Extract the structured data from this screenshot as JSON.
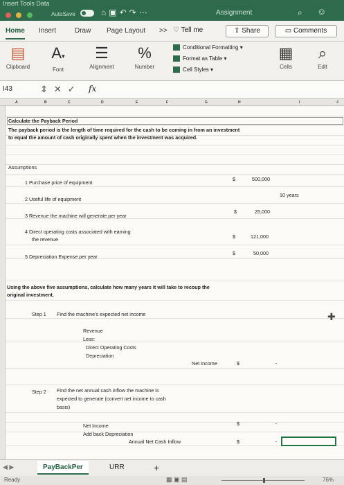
{
  "titlebar": {
    "menu_text": "Insert   Tools   Data",
    "autosave": "AutoSave",
    "assignment": "Assignment"
  },
  "ribbon_tabs": {
    "home": "Home",
    "insert": "Insert",
    "draw": "Draw",
    "page_layout": "Page Layout",
    "more": ">>",
    "tell_me": "Tell me",
    "share": "Share",
    "comments": "Comments"
  },
  "ribbon": {
    "clipboard": "Clipboard",
    "font": "Font",
    "alignment": "Alignment",
    "number": "Number",
    "conditional_formatting": "Conditional Formatting",
    "format_as_table": "Format as Table",
    "cell_styles": "Cell Styles",
    "cells": "Cells",
    "edit": "Edit"
  },
  "formula_bar": {
    "name_box": "I43",
    "fx": "fx"
  },
  "columns": [
    "A",
    "B",
    "C",
    "D",
    "E",
    "F",
    "G",
    "H",
    "I",
    "J"
  ],
  "sheet": {
    "title": "Calculate the Payback Period",
    "intro_1": "The payback period is the length of time required for the cash to be coming in from an investment",
    "intro_2": "to equal the amount of cash originally spent when the investment was acquired.",
    "assumptions_label": "Assumptions",
    "a1_label": "1 Purchase price of equipment",
    "a1_cur": "$",
    "a1_val": "500,000",
    "a2_label": "2 Useful life of equipment",
    "a2_val": "10 years",
    "a3_label": "3 Revenue the machine will generate per year",
    "a3_cur": "$",
    "a3_val": "25,000",
    "a4_label_1": "4 Direct operating costs associated with earning",
    "a4_label_2": "the revenue",
    "a4_cur": "$",
    "a4_val": "121,000",
    "a5_label": "5 Depreciation Expense per year",
    "a5_cur": "$",
    "a5_val": "50,000",
    "q_1": "Using the above five assumptions, calculate how many years it will take to recoup the",
    "q_2": "original investment.",
    "step1": "Step 1",
    "step1_desc": "Find the machine's expected net income",
    "revenue": "Revenue",
    "less": "Less:",
    "doc": "Direct Operating Costs",
    "depr": "Depreciation",
    "net_income": "Net Income",
    "ni_cur": "$",
    "ni_dash": "-",
    "step2": "Step 2",
    "step2_desc_1": "Find the net annual cash inflow the machine is",
    "step2_desc_2": "expected to generate (convert net income to cash",
    "step2_desc_3": "basis)",
    "s2_net_income": "Net Income",
    "s2_ni_cur": "$",
    "s2_ni_dash": "-",
    "add_back": "Add back Depreciation",
    "ancf": "Annual Net Cash Inflow",
    "ancf_cur": "$",
    "ancf_dash": "-"
  },
  "sheet_tabs": {
    "payback": "PayBackPer",
    "urr": "URR",
    "add": "+"
  },
  "status": {
    "ready": "Ready",
    "zoom": "76%"
  }
}
